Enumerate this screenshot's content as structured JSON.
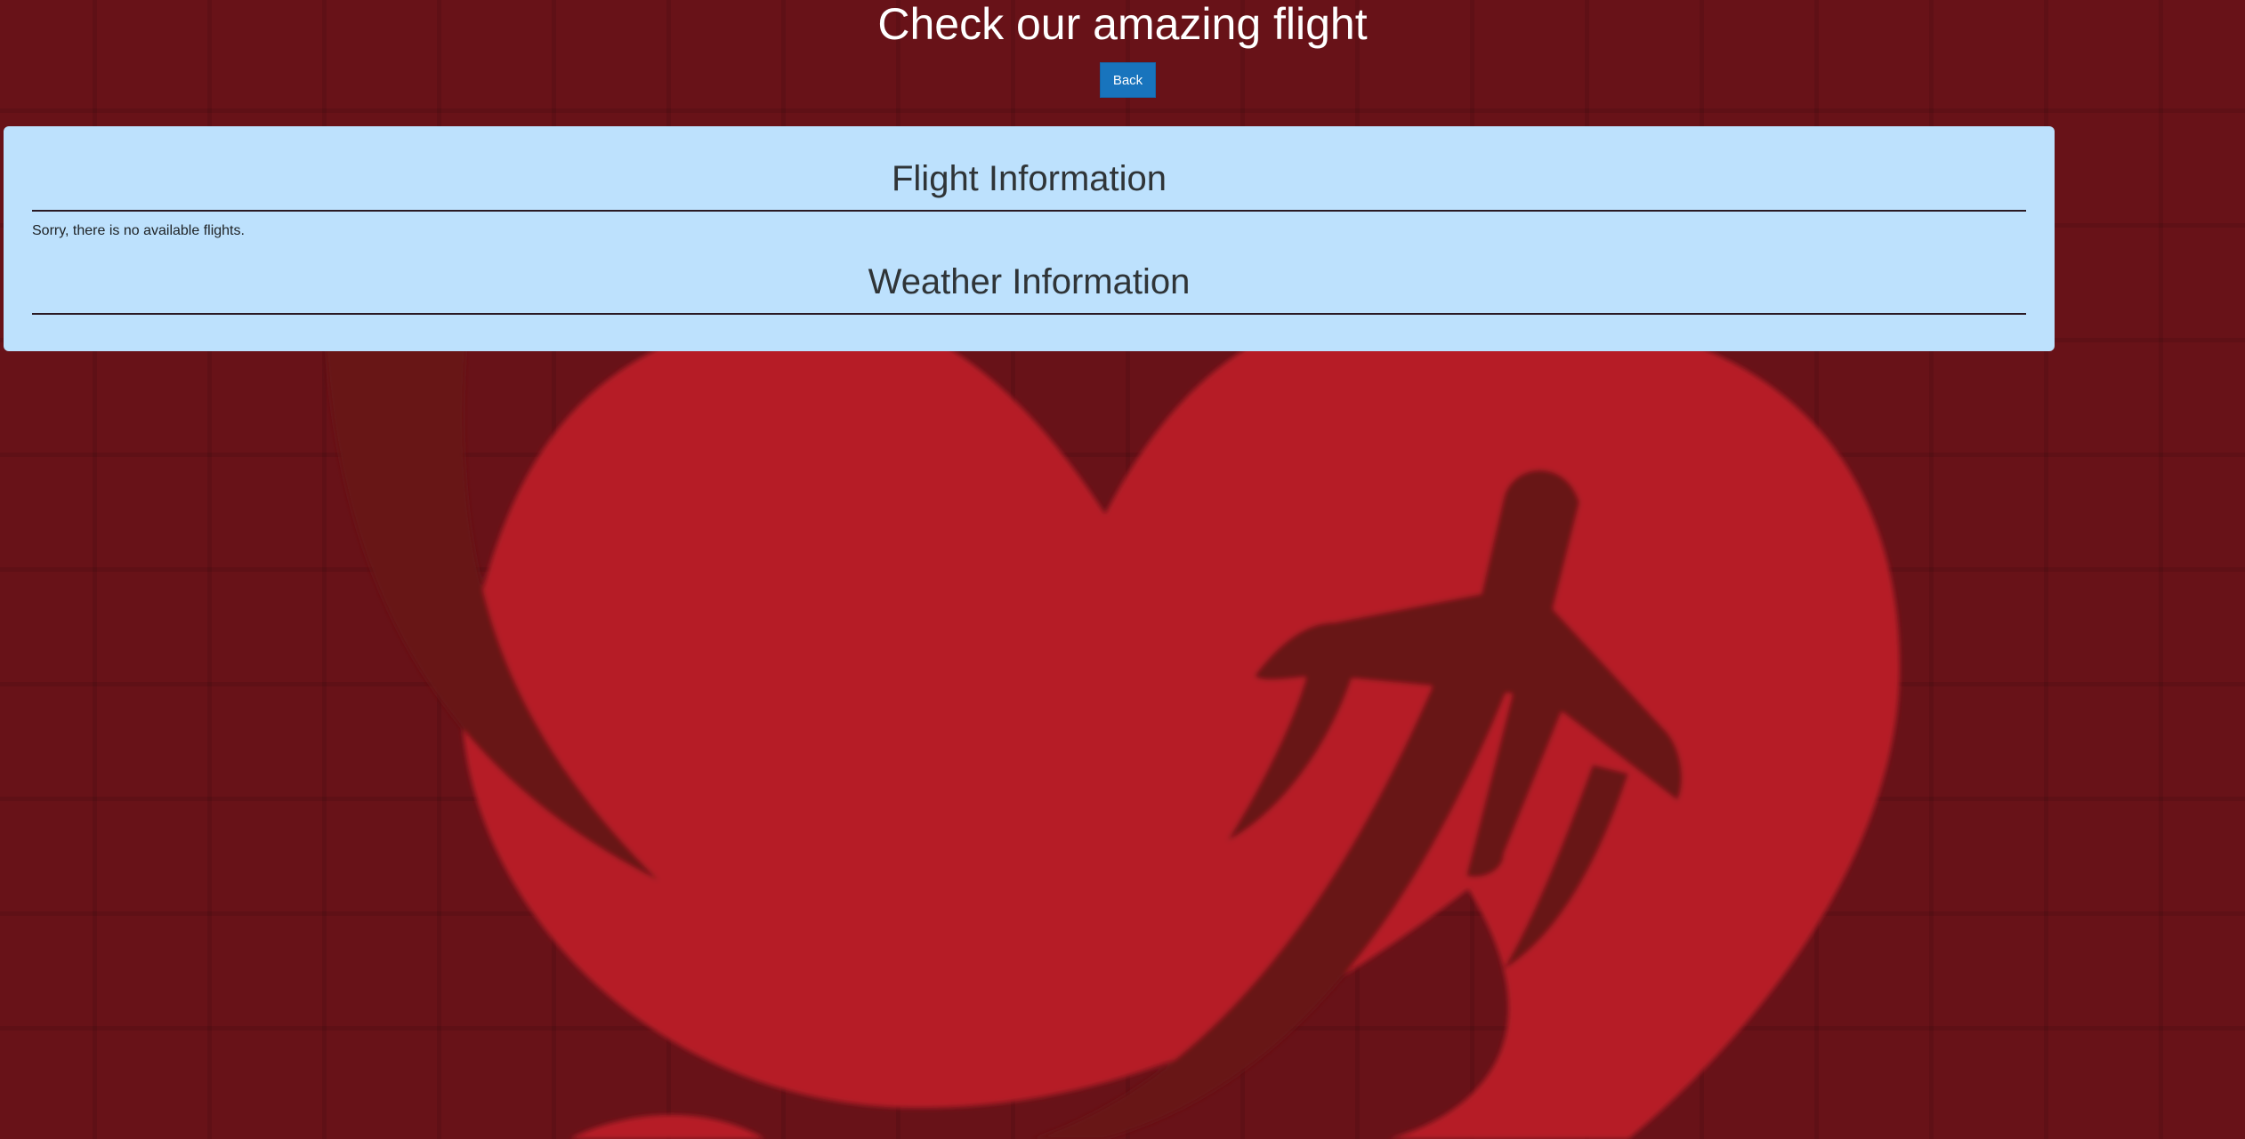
{
  "page": {
    "title": "Check our amazing flight"
  },
  "nav": {
    "back_label": "Back"
  },
  "panel": {
    "flight_heading": "Flight Information",
    "flight_status": "Sorry, there is no available flights.",
    "weather_heading": "Weather Information"
  },
  "theme": {
    "background": "#681218",
    "logo_red": "#b61f27",
    "panel_bg": "#bde1fd",
    "button_bg": "#1874bd"
  },
  "background_logo": {
    "icon": "heart-airplane-logo-icon"
  }
}
